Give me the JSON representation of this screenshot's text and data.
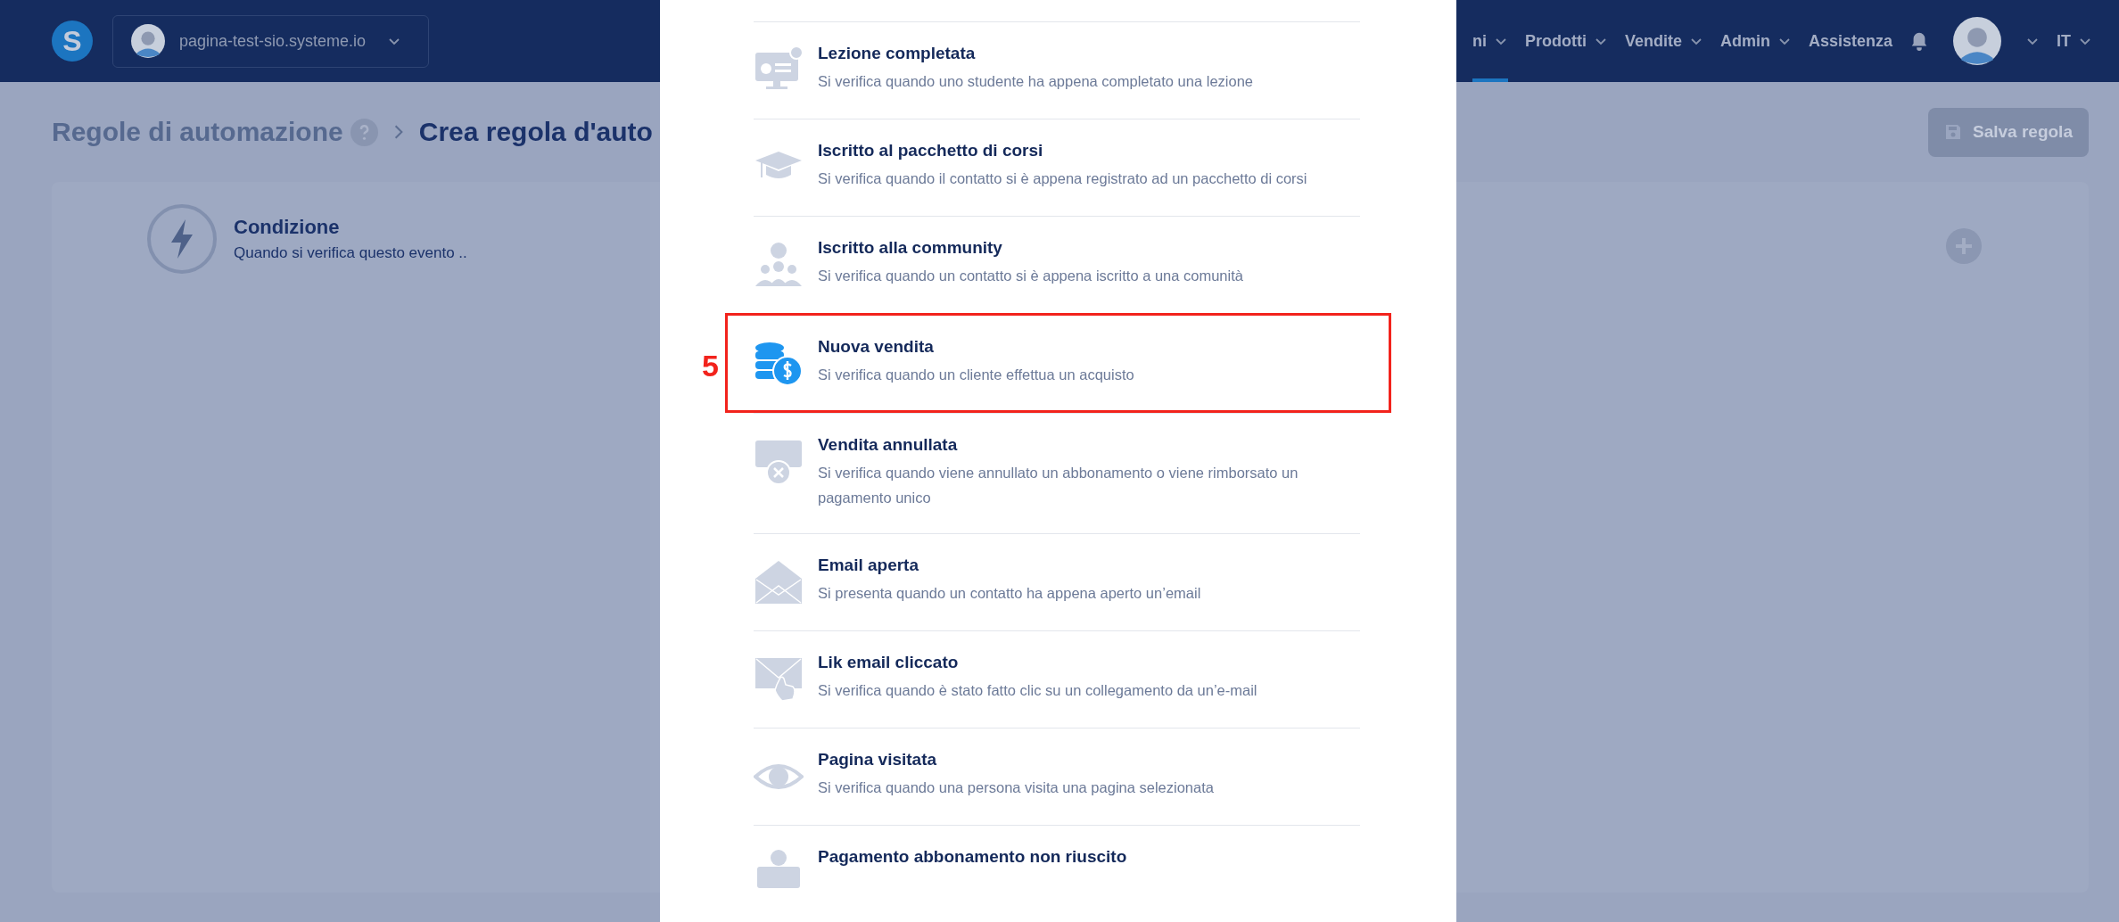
{
  "top_bar": {
    "logo": "S",
    "site_selector": "pagina-test-sio.systeme.io",
    "language": "IT",
    "nav": [
      {
        "label": "ni",
        "selected": true,
        "has_menu": true
      },
      {
        "label": "Prodotti",
        "selected": false,
        "has_menu": true
      },
      {
        "label": "Vendite",
        "selected": false,
        "has_menu": true
      },
      {
        "label": "Admin",
        "selected": false,
        "has_menu": true
      },
      {
        "label": "Assistenza",
        "selected": false,
        "has_menu": false
      }
    ]
  },
  "breadcrumb": {
    "parent": "Regole di automazione",
    "current": "Crea regola d'auto"
  },
  "save_button": "Salva regola",
  "condition": {
    "title": "Condizione",
    "subtitle": "Quando si verifica questo evento .."
  },
  "event_list": [
    {
      "title": "Lezione completata",
      "description": "Si verifica quando uno studente ha appena completato una lezione",
      "highlighted": false
    },
    {
      "title": "Iscritto al pacchetto di corsi",
      "description": "Si verifica quando il contatto si è appena registrato ad un pacchetto di corsi",
      "highlighted": false
    },
    {
      "title": "Iscritto alla community",
      "description": "Si verifica quando un contatto si è appena iscritto a una comunità",
      "highlighted": false
    },
    {
      "title": "Nuova vendita",
      "description": "Si verifica quando un cliente effettua un acquisto",
      "highlighted": true,
      "callout": "5"
    },
    {
      "title": "Vendita annullata",
      "description": "Si verifica quando viene annullato un abbonamento o viene rimborsato un pagamento unico",
      "highlighted": false
    },
    {
      "title": "Email aperta",
      "description": "Si presenta quando un contatto ha appena aperto un’email",
      "highlighted": false
    },
    {
      "title": "Lik email cliccato",
      "description": "Si verifica quando è stato fatto clic su un collegamento da un’e-mail",
      "highlighted": false
    },
    {
      "title": "Pagina visitata",
      "description": "Si verifica quando una persona visita una pagina selezionata",
      "highlighted": false
    },
    {
      "title": "Pagamento abbonamento non riuscito",
      "highlighted": false
    }
  ]
}
